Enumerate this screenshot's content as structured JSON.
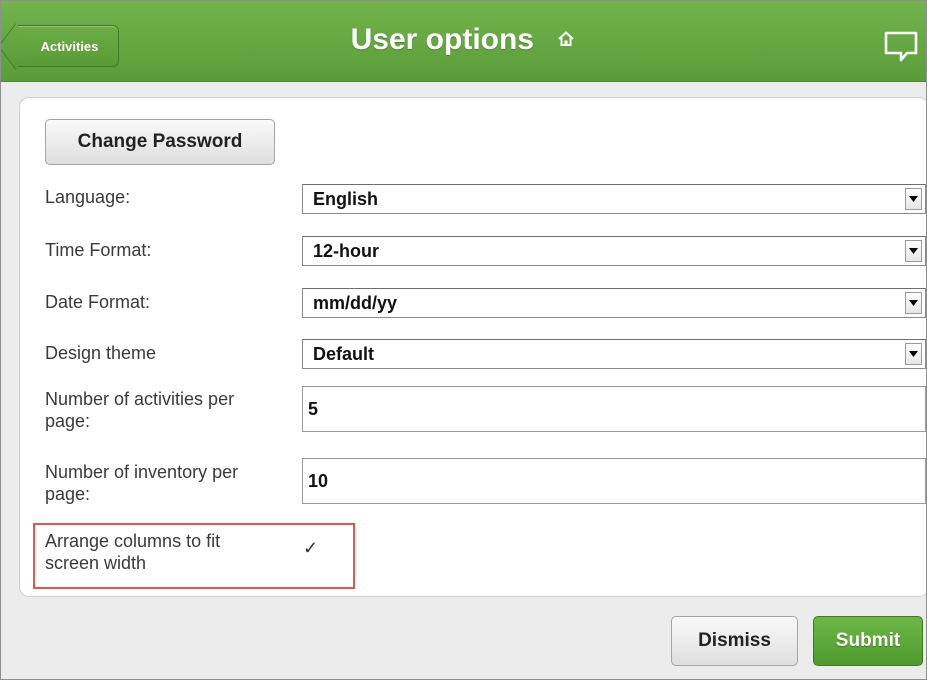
{
  "header": {
    "back_label": "Activities",
    "title": "User options"
  },
  "colors": {
    "header_green": "#5fa23c",
    "highlight_red": "#e05650"
  },
  "icons": {
    "home": "home-icon",
    "chat": "chat-icon",
    "dropdown": "dropdown-arrow-icon",
    "checkbox": "checkmark-icon"
  },
  "form": {
    "change_password_label": "Change Password",
    "language": {
      "label": "Language:",
      "value": "English"
    },
    "time_format": {
      "label": "Time Format:",
      "value": "12-hour"
    },
    "date_format": {
      "label": "Date Format:",
      "value": "mm/dd/yy"
    },
    "design_theme": {
      "label": "Design theme",
      "value": "Default"
    },
    "activities_per_page": {
      "label_line1": "Number of activities per",
      "label_line2": "page:",
      "value": "5"
    },
    "inventory_per_page": {
      "label_line1": "Number of inventory per",
      "label_line2": "page:",
      "value": "10"
    },
    "arrange_columns": {
      "label_line1": "Arrange columns to fit",
      "label_line2": "screen width",
      "checked": true,
      "mark": "✓"
    }
  },
  "footer": {
    "dismiss_label": "Dismiss",
    "submit_label": "Submit"
  }
}
